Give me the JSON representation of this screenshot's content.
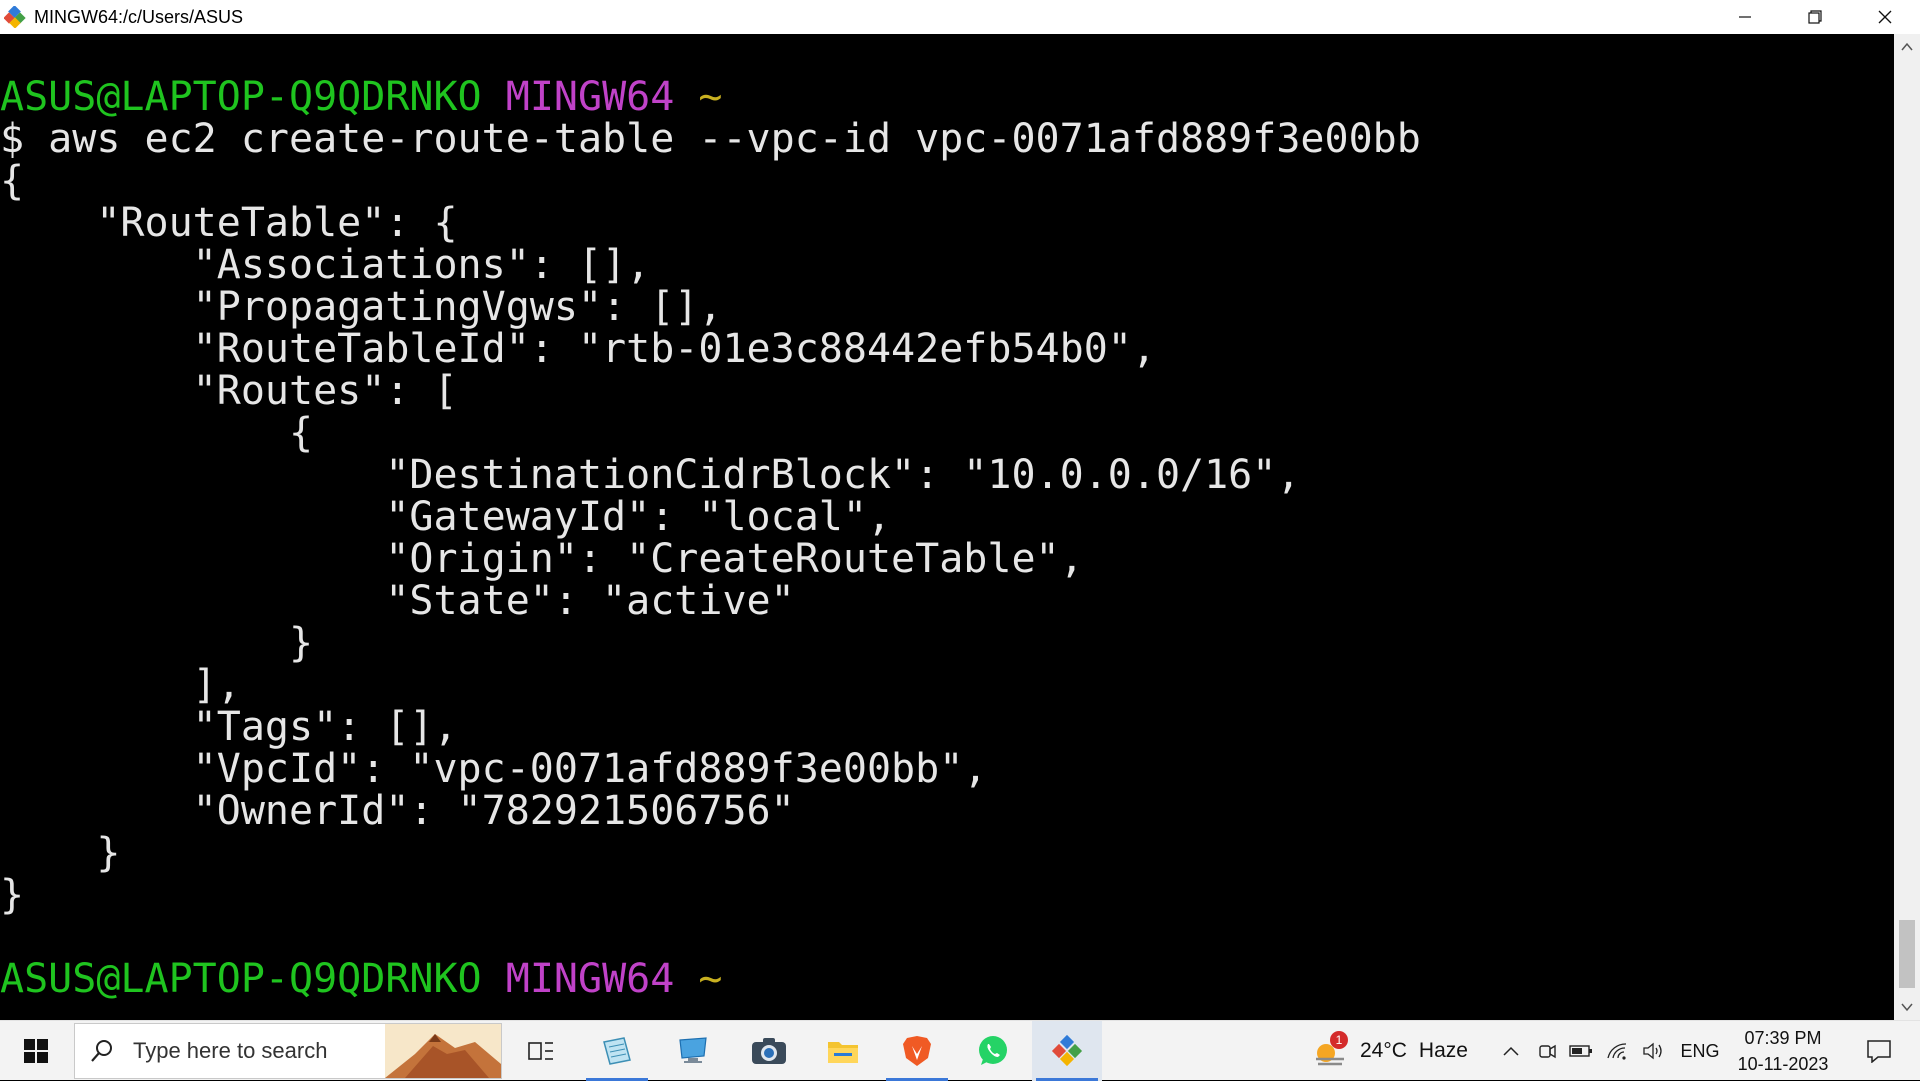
{
  "window": {
    "title": "MINGW64:/c/Users/ASUS",
    "app_icon": "git-bash-icon",
    "controls": [
      "minimize-icon",
      "restore-icon",
      "close-icon"
    ]
  },
  "terminal": {
    "colors": {
      "background": "#000000",
      "text": "#e6e6e6",
      "user_host": "#1fc41f",
      "shell": "#c042c8",
      "path": "#c8b020"
    },
    "prompt1": {
      "user_host": "ASUS@LAPTOP-Q9QDRNKO",
      "shell": "MINGW64",
      "path": "~"
    },
    "command": "$ aws ec2 create-route-table --vpc-id vpc-0071afd889f3e00bb",
    "output_lines": [
      "{",
      "    \"RouteTable\": {",
      "        \"Associations\": [],",
      "        \"PropagatingVgws\": [],",
      "        \"RouteTableId\": \"rtb-01e3c88442efb54b0\",",
      "        \"Routes\": [",
      "            {",
      "                \"DestinationCidrBlock\": \"10.0.0.0/16\",",
      "                \"GatewayId\": \"local\",",
      "                \"Origin\": \"CreateRouteTable\",",
      "                \"State\": \"active\"",
      "            }",
      "        ],",
      "        \"Tags\": [],",
      "        \"VpcId\": \"vpc-0071afd889f3e00bb\",",
      "        \"OwnerId\": \"782921506756\"",
      "    }",
      "}"
    ],
    "prompt2": {
      "user_host": "ASUS@LAPTOP-Q9QDRNKO",
      "shell": "MINGW64",
      "path": "~"
    }
  },
  "taskbar": {
    "search_placeholder": "Type here to search",
    "apps": [
      "task-view-icon",
      "notepad-icon",
      "this-pc-icon",
      "camera-icon",
      "file-explorer-icon",
      "brave-browser-icon",
      "whatsapp-icon",
      "git-bash-icon"
    ],
    "weather": {
      "temp": "24°C",
      "condition": "Haze",
      "badge": "1"
    },
    "tray_icons": [
      "chevron-up-icon",
      "meet-now-icon",
      "battery-icon",
      "wifi-icon",
      "volume-icon"
    ],
    "language": "ENG",
    "time": "07:39 PM",
    "date": "10-11-2023"
  }
}
